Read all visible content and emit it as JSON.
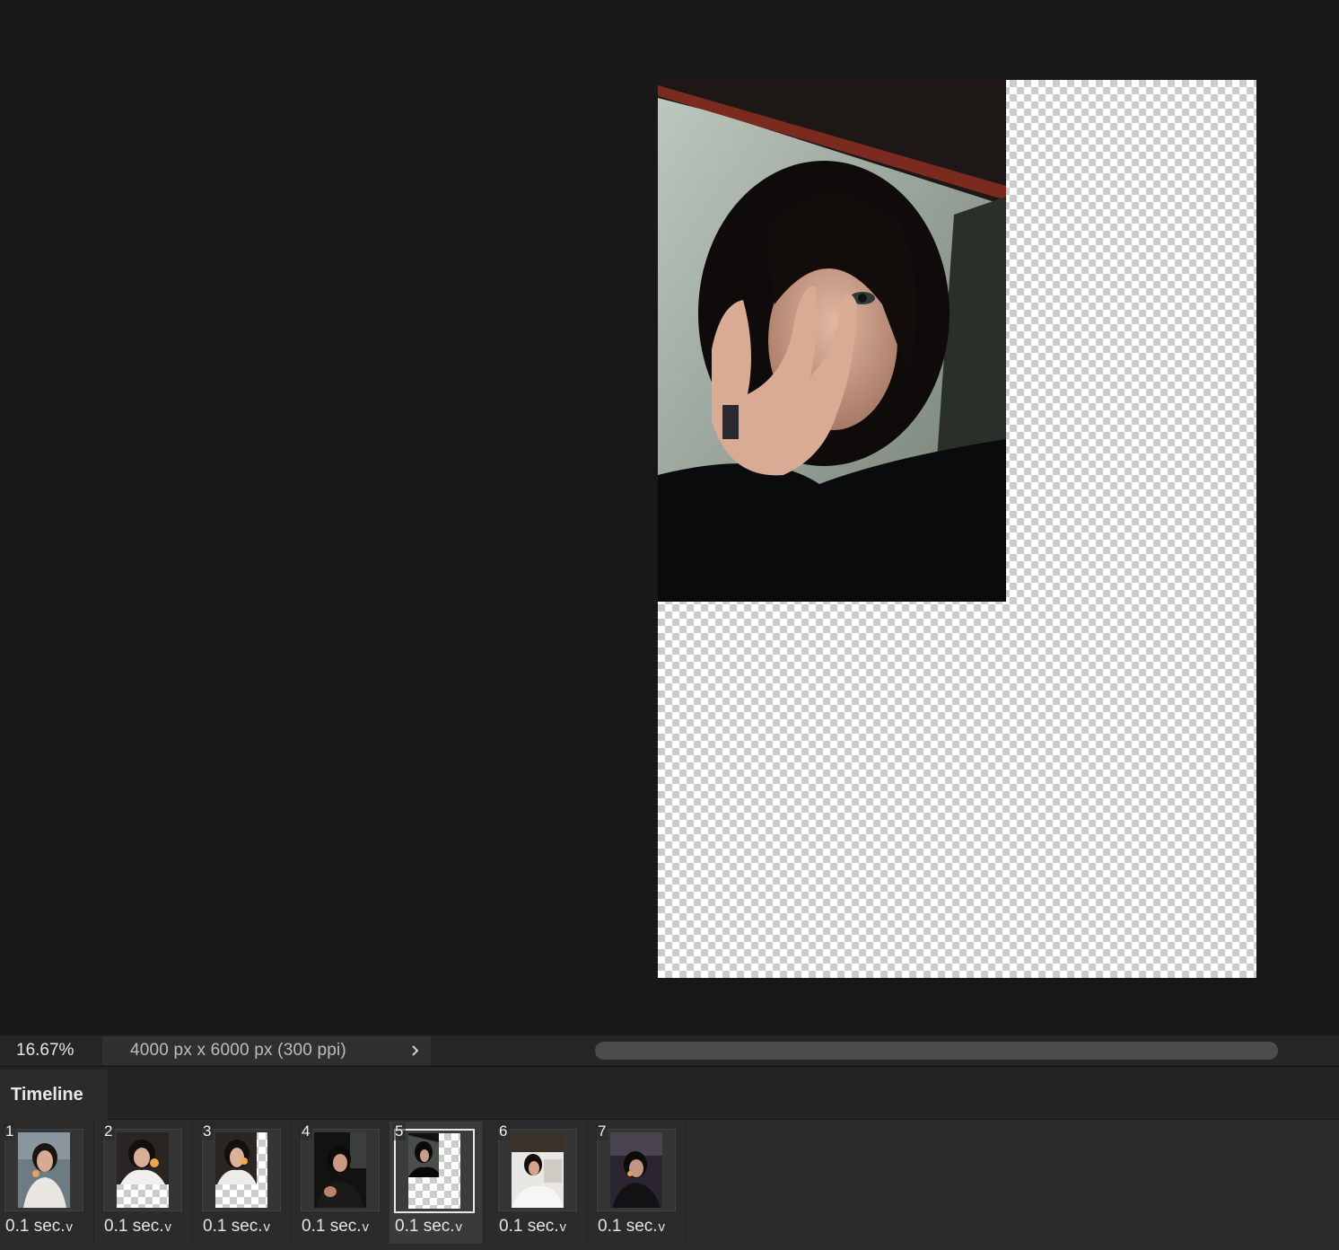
{
  "status_bar": {
    "zoom": "16.67%",
    "document_size": "4000 px x 6000 px (300 ppi)"
  },
  "timeline": {
    "tab_label": "Timeline",
    "frames": [
      {
        "number": "1",
        "delay": "0.1 sec.",
        "selected": false
      },
      {
        "number": "2",
        "delay": "0.1 sec.",
        "selected": false
      },
      {
        "number": "3",
        "delay": "0.1 sec.",
        "selected": false
      },
      {
        "number": "4",
        "delay": "0.1 sec.",
        "selected": false
      },
      {
        "number": "5",
        "delay": "0.1 sec.",
        "selected": true
      },
      {
        "number": "6",
        "delay": "0.1 sec.",
        "selected": false
      },
      {
        "number": "7",
        "delay": "0.1 sec.",
        "selected": false
      }
    ]
  },
  "colors": {
    "workspace": "#181818",
    "panel": "#2b2b2b",
    "selected_frame": "#3a3a3a",
    "scrollbar": "#4c4c4c"
  }
}
